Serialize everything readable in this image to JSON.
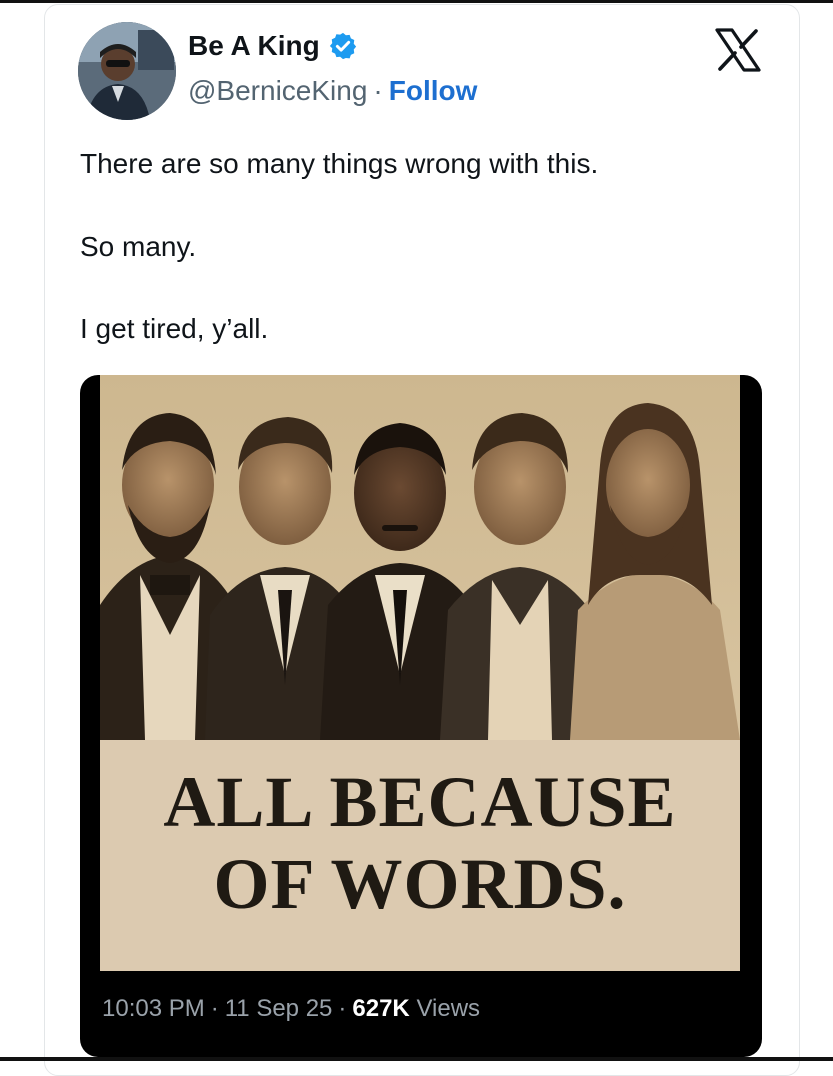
{
  "author": {
    "display_name": "Be A King",
    "handle": "@BerniceKing",
    "separator": "·",
    "follow_label": "Follow"
  },
  "tweet": {
    "lines": [
      "There are so many things wrong with this.",
      "So many.",
      "I get tired, y’all."
    ]
  },
  "media": {
    "caption_line_1": "ALL BECAUSE",
    "caption_line_2": "OF WORDS."
  },
  "meta": {
    "time": "10:03 PM",
    "date": "11 Sep 25",
    "views_count": "627K",
    "views_label": "Views",
    "separator": "·"
  },
  "colors": {
    "follow": "#1d6fd0",
    "verified": "#1d9bf0",
    "text": "#0f1419",
    "muted": "#536471",
    "poster_bg": "#d9c6a2"
  },
  "icons": {
    "brand": "x-logo-icon",
    "verified": "verified-badge-icon"
  }
}
